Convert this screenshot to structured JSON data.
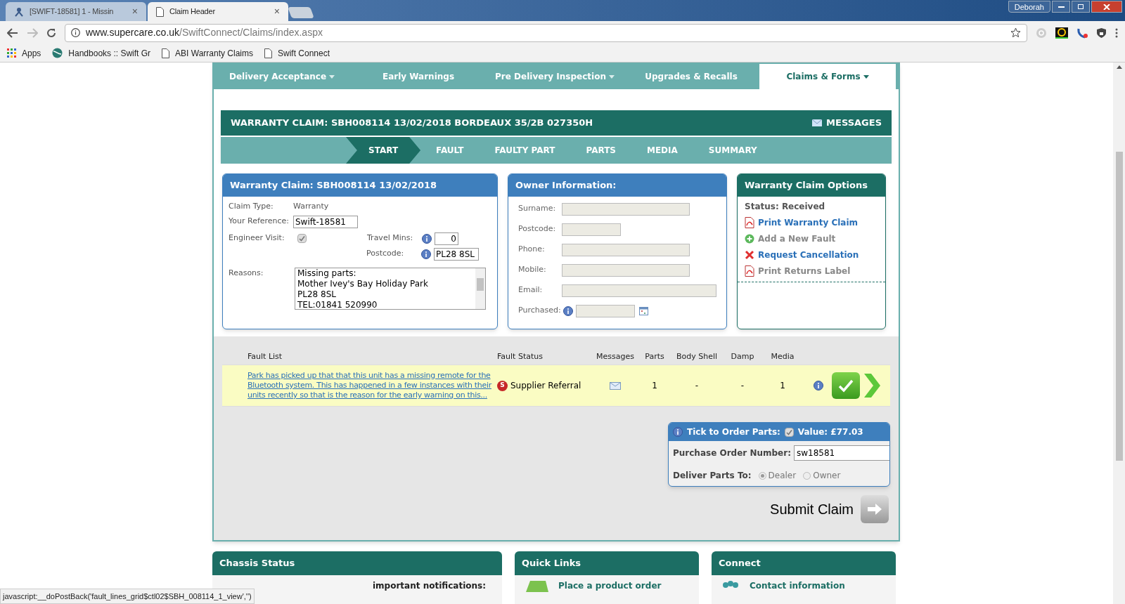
{
  "browser": {
    "tabs": [
      {
        "title": "[SWIFT-18581] 1 - Missin",
        "close": "×",
        "selected": false
      },
      {
        "title": "Claim Header",
        "close": "×",
        "selected": true
      }
    ],
    "user": "Deborah",
    "url": {
      "host": "www.supercare.co.uk",
      "path": "/SwiftConnect/Claims/index.aspx"
    },
    "bookmarks": [
      {
        "kind": "apps",
        "label": "Apps"
      },
      {
        "kind": "globe",
        "label": "Handbooks :: Swift Gr"
      },
      {
        "kind": "page",
        "label": "ABI Warranty Claims"
      },
      {
        "kind": "page",
        "label": "Swift Connect"
      }
    ]
  },
  "nav_tabs": [
    {
      "label": "Delivery Acceptance",
      "dropdown": true,
      "selected": false
    },
    {
      "label": "Early Warnings",
      "dropdown": false,
      "selected": false
    },
    {
      "label": "Pre Delivery Inspection",
      "dropdown": true,
      "selected": false
    },
    {
      "label": "Upgrades & Recalls",
      "dropdown": false,
      "selected": false
    },
    {
      "label": "Claims & Forms",
      "dropdown": true,
      "selected": true
    }
  ],
  "claim_header": {
    "title": "WARRANTY CLAIM: SBH008114 13/02/2018 BORDEAUX 35/2B 027350H",
    "messages": "MESSAGES"
  },
  "steps": [
    {
      "label": "START",
      "selected": true
    },
    {
      "label": "FAULT",
      "selected": false
    },
    {
      "label": "FAULTY PART",
      "selected": false
    },
    {
      "label": "PARTS",
      "selected": false
    },
    {
      "label": "MEDIA",
      "selected": false
    },
    {
      "label": "SUMMARY",
      "selected": false
    }
  ],
  "claim_panel": {
    "title": "Warranty Claim: SBH008114 13/02/2018",
    "claim_type_label": "Claim Type:",
    "claim_type": "Warranty",
    "reference_label": "Your Reference:",
    "reference": "Swift-18581",
    "engineer_label": "Engineer Visit:",
    "engineer_checked": true,
    "travel_label": "Travel Mins:",
    "travel": "0",
    "postcode_label": "Postcode:",
    "postcode": "PL28 8SL",
    "reasons_label": "Reasons:",
    "reasons": [
      "Missing parts:",
      "Mother Ivey's Bay Holiday Park",
      "PL28 8SL",
      "TEL:01841 520990"
    ]
  },
  "owner_panel": {
    "title": "Owner Information:",
    "fields": [
      {
        "label": "Surname:",
        "info": false
      },
      {
        "label": "Postcode:",
        "info": false
      },
      {
        "label": "Phone:",
        "info": false
      },
      {
        "label": "Mobile:",
        "info": false
      },
      {
        "label": "Email:",
        "info": false
      },
      {
        "label": "Purchased:",
        "info": true
      }
    ]
  },
  "options_panel": {
    "title": "Warranty Claim Options",
    "status": "Status: Received",
    "items": [
      {
        "kind": "pdf",
        "label": "Print Warranty Claim",
        "disabled": false
      },
      {
        "kind": "add",
        "label": "Add a New Fault",
        "disabled": true
      },
      {
        "kind": "cancel",
        "label": "Request Cancellation",
        "disabled": false
      },
      {
        "kind": "pdf",
        "label": "Print Returns Label",
        "disabled": true
      }
    ]
  },
  "fault_table": {
    "columns": [
      "Fault List",
      "Fault Status",
      "Messages",
      "Parts",
      "Body Shell",
      "Damp",
      "Media"
    ],
    "rows": [
      {
        "description": "Park has picked up that that this unit has a missing remote for the Bluetooth system. This has happened in a few instances with their units recently so that is the reason for the early warning on this...",
        "status_badge": "S",
        "status": "Supplier Referral",
        "parts": "1",
        "body_shell": "-",
        "damp": "-",
        "media": "1"
      }
    ]
  },
  "order_parts": {
    "tick_label": "Tick to Order Parts:",
    "tick_checked": true,
    "value": "Value: £77.03",
    "po_label": "Purchase Order Number:",
    "po": "sw18581",
    "deliver_label": "Deliver Parts To:",
    "deliver_options": [
      {
        "label": "Dealer",
        "selected": true
      },
      {
        "label": "Owner",
        "selected": false
      }
    ]
  },
  "submit": "Submit Claim",
  "bottom_panels": [
    {
      "title": "Chassis Status",
      "line": "important notifications:"
    },
    {
      "title": "Quick Links",
      "line": "Place a product order"
    },
    {
      "title": "Connect",
      "line": "Contact information"
    }
  ],
  "status_bar": "javascript:__doPostBack('fault_lines_grid$ctl02$SBH_008114_1_view','')"
}
